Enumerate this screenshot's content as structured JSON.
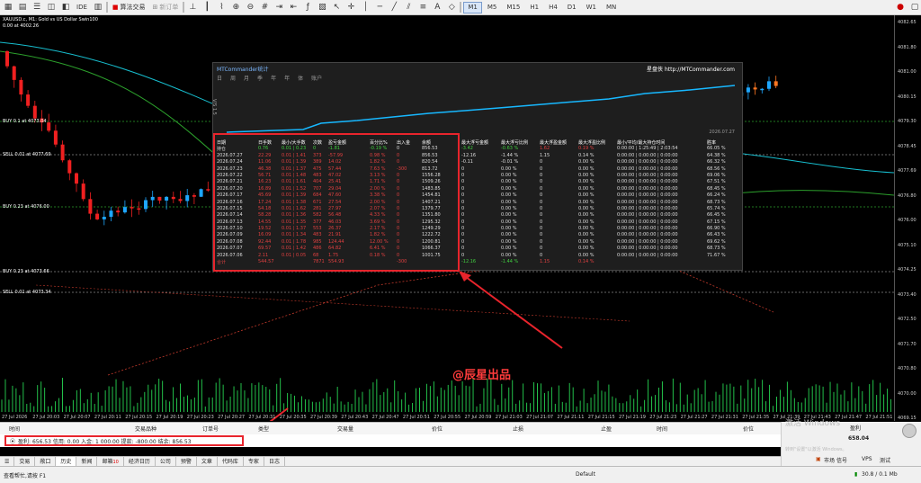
{
  "toolbar": {
    "algo_label": "算法交易",
    "new_order_label": "新订单",
    "ide_label": "IDE",
    "timeframes": [
      "M1",
      "M5",
      "M15",
      "H1",
      "H4",
      "D1",
      "W1",
      "MN"
    ],
    "active_timeframe": "M1"
  },
  "chart": {
    "symbol_line": "XAUUSD.c, M1: Gold vs US Dollar Swin100",
    "symbol_line2": "0.00 at 4002.26",
    "order_labels": [
      {
        "text": "BUY 0.1 at 4073.04"
      },
      {
        "text": "SELL 0.01 at 4077.69"
      },
      {
        "text": "BUY 0.23 at 4076.00"
      },
      {
        "text": "BUY 0.23 at 4073.66"
      },
      {
        "text": "SELL 0.01 at 4073.34"
      }
    ],
    "price_levels": [
      "4082.65",
      "4081.80",
      "4081.00",
      "4080.15",
      "4079.30",
      "4078.45",
      "4077.69",
      "4076.80",
      "4076.00",
      "4075.10",
      "4074.25",
      "4073.40",
      "4072.50",
      "4071.70",
      "4070.80",
      "4070.00",
      "4069.15"
    ],
    "time_labels": [
      "27 Jul 2026",
      "27 Jul 20:03",
      "27 Jul 20:07",
      "27 Jul 20:11",
      "27 Jul 20:15",
      "27 Jul 20:19",
      "27 Jul 20:23",
      "27 Jul 20:27",
      "27 Jul 20:31",
      "27 Jul 20:35",
      "27 Jul 20:39",
      "27 Jul 20:43",
      "27 Jul 20:47",
      "27 Jul 20:51",
      "27 Jul 20:55",
      "27 Jul 20:59",
      "27 Jul 21:03",
      "27 Jul 21:07",
      "27 Jul 21:11",
      "27 Jul 21:15",
      "27 Jul 21:19",
      "27 Jul 21:23",
      "27 Jul 21:27",
      "27 Jul 21:31",
      "27 Jul 21:35",
      "27 Jul 21:39",
      "27 Jul 21:43",
      "27 Jul 21:47",
      "27 Jul 21:51"
    ],
    "colors": {
      "bull": "#1ea7ff",
      "bear": "#f02020",
      "bear2": "#ff7722",
      "ma1": "#2ca02c",
      "ma2": "#17becf",
      "volume": "#23c04a"
    }
  },
  "stats_popup": {
    "title": "MTCommander统计",
    "brand": "星盘侠 http://MTCommander.com",
    "tabs": [
      "日",
      "周",
      "月",
      "季",
      "年",
      "年",
      "体",
      "账户"
    ],
    "date_label": "2026.07.27",
    "axis_label": "V/S 1.5",
    "headers": [
      "日期",
      "日手数",
      "最小/大手数",
      "次数",
      "盈亏金额",
      "百分比%",
      "出入金",
      "余额",
      "最大浮亏金额",
      "最大浮亏比例",
      "最大浮盈金额",
      "最大浮盈比例",
      "最小/平均/最大持仓时间",
      "胜率"
    ],
    "summary": [
      "持仓",
      "0.76",
      "0.01 | 0.23",
      "0",
      "-1.81",
      "-0.19 %",
      "0",
      "856.53",
      "-3.42",
      "-0.63 %",
      "1.62",
      "0.19 %",
      "0:00:00 | 1:25:49 | 2:03:54",
      "66.05 %"
    ],
    "rows": [
      [
        "2026.07.27",
        "22.29",
        "0.01 | 1.41",
        "373",
        "-57.99",
        "0.98 %",
        "0",
        "856.53",
        "-12.16",
        "-1.44 %",
        "1.15",
        "0.14 %",
        "0:00:00 | 0:00:00 | 0:00:00",
        "64.38 %"
      ],
      [
        "2026.07.24",
        "11.06",
        "0.01 | 1.39",
        "389",
        "14.02",
        "1.82 %",
        "0",
        "820.54",
        "-0.11",
        "-0.01 %",
        "0",
        "0.00 %",
        "0:00:00 | 0:00:00 | 0:00:00",
        "66.32 %"
      ],
      [
        "2026.07.23",
        "46.38",
        "0.01 | 1.37",
        "475",
        "57.44",
        "7.63 %",
        "-300",
        "813.72",
        "0",
        "0.00 %",
        "0",
        "0.00 %",
        "0:00:00 | 0:00:00 | 0:00:00",
        "68.56 %"
      ],
      [
        "2026.07.22",
        "56.71",
        "0.01 | 1.48",
        "483",
        "47.02",
        "3.13 %",
        "0",
        "1556.28",
        "0",
        "0.00 %",
        "0",
        "0.00 %",
        "0:00:00 | 0:00:00 | 0:00:00",
        "69.06 %"
      ],
      [
        "2026.07.21",
        "16.23",
        "0.01 | 1.61",
        "404",
        "25.41",
        "1.71 %",
        "0",
        "1509.26",
        "0",
        "0.00 %",
        "0",
        "0.00 %",
        "0:00:00 | 0:00:00 | 0:00:00",
        "67.51 %"
      ],
      [
        "2026.07.20",
        "16.89",
        "0.01 | 1.52",
        "707",
        "29.04",
        "2.00 %",
        "0",
        "1483.85",
        "0",
        "0.00 %",
        "0",
        "0.00 %",
        "0:00:00 | 0:00:00 | 0:00:00",
        "68.45 %"
      ],
      [
        "2026.07.17",
        "45.69",
        "0.01 | 1.39",
        "684",
        "47.60",
        "3.38 %",
        "0",
        "1454.81",
        "0",
        "0.00 %",
        "0",
        "0.00 %",
        "0:00:00 | 0:00:00 | 0:00:00",
        "66.24 %"
      ],
      [
        "2026.07.16",
        "17.24",
        "0.01 | 1.38",
        "671",
        "27.54",
        "2.00 %",
        "0",
        "1407.21",
        "0",
        "0.00 %",
        "0",
        "0.00 %",
        "0:00:00 | 0:00:00 | 0:00:00",
        "68.73 %"
      ],
      [
        "2026.07.15",
        "54.18",
        "0.01 | 1.62",
        "281",
        "27.97",
        "2.07 %",
        "0",
        "1379.77",
        "0",
        "0.00 %",
        "0",
        "0.00 %",
        "0:00:00 | 0:00:00 | 0:00:00",
        "65.74 %"
      ],
      [
        "2026.07.14",
        "58.28",
        "0.01 | 1.36",
        "582",
        "56.48",
        "4.33 %",
        "0",
        "1351.80",
        "0",
        "0.00 %",
        "0",
        "0.00 %",
        "0:00:00 | 0:00:00 | 0:00:00",
        "66.45 %"
      ],
      [
        "2026.07.13",
        "14.55",
        "0.01 | 1.35",
        "377",
        "46.03",
        "3.69 %",
        "0",
        "1295.32",
        "0",
        "0.00 %",
        "0",
        "0.00 %",
        "0:00:00 | 0:00:00 | 0:00:00",
        "67.15 %"
      ],
      [
        "2026.07.10",
        "19.52",
        "0.01 | 1.37",
        "553",
        "26.37",
        "2.17 %",
        "0",
        "1249.29",
        "0",
        "0.00 %",
        "0",
        "0.00 %",
        "0:00:00 | 0:00:00 | 0:00:00",
        "66.90 %"
      ],
      [
        "2026.07.09",
        "16.09",
        "0.01 | 1.34",
        "483",
        "21.91",
        "1.82 %",
        "0",
        "1222.72",
        "0",
        "0.00 %",
        "0",
        "0.00 %",
        "0:00:00 | 0:00:00 | 0:00:00",
        "66.43 %"
      ],
      [
        "2026.07.08",
        "92.44",
        "0.01 | 1.78",
        "985",
        "124.44",
        "12.00 %",
        "0",
        "1200.81",
        "0",
        "0.00 %",
        "0",
        "0.00 %",
        "0:00:00 | 0:00:00 | 0:00:00",
        "69.62 %"
      ],
      [
        "2026.07.07",
        "69.57",
        "0.01 | 1.42",
        "486",
        "64.82",
        "6.41 %",
        "0",
        "1066.37",
        "0",
        "0.00 %",
        "0",
        "0.00 %",
        "0:00:00 | 0:00:00 | 0:00:00",
        "68.73 %"
      ],
      [
        "2026.07.06",
        "2.11",
        "0.01 | 0.05",
        "68",
        "1.75",
        "0.18 %",
        "0",
        "1001.75",
        "0",
        "0.00 %",
        "0",
        "0.00 %",
        "0:00:00 | 0:00:00 | 0:00:00",
        "71.67 %"
      ]
    ],
    "total": [
      "合计",
      "544.57",
      "",
      "7871",
      "554.93",
      "",
      "-300",
      "",
      "-12.16",
      "-1.44 %",
      "1.15",
      "0.14 %",
      "",
      ""
    ]
  },
  "annotation": "@辰星出品",
  "terminal": {
    "headers": [
      "时间",
      "交易品种",
      "订单号",
      "类型",
      "交易量",
      "价位",
      "止损",
      "止盈",
      "时间",
      "价位",
      "盈利"
    ],
    "balance_line": "盈利: 656.53  信用: 0.00  入金: 1 000.00  提款: -800.00  结余: 856.53",
    "profit_value": "658.04",
    "tabs": [
      "交易",
      "敞口",
      "历史",
      "新闻",
      "邮箱",
      "经济日历",
      "公司",
      "预警",
      "文章",
      "代码库",
      "专家",
      "日志"
    ],
    "mail_count": "10",
    "active_tab": "历史",
    "watermark1": "激活 Windows",
    "watermark2": "转到\"设置\"以激活 Windows。"
  },
  "statusbar": {
    "help": "查看帮忙,请按 F1",
    "profile": "Default",
    "market": "市场",
    "signals": "信号",
    "vps": "VPS",
    "test": "测试",
    "connection": "30.8 / 0.1 Mb"
  }
}
